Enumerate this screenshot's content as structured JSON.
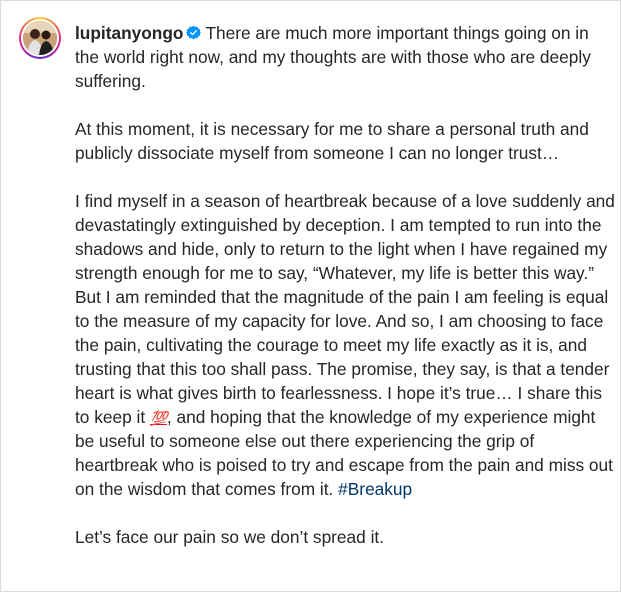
{
  "post": {
    "username": "lupitanyongo",
    "verified": true,
    "caption": {
      "p1": "There are much more important things going on in the world right now, and my thoughts are with those who are deeply suffering.",
      "p2": "At this moment, it is necessary for me to share a personal truth and publicly dissociate myself from someone I can no longer trust…",
      "p3_before_emoji": "I find myself in a season of heartbreak because of a love suddenly and devastatingly extinguished by deception. I am tempted to run into the shadows and hide, only to return to the light when I have regained my strength enough for me to say, “Whatever, my life is better this way.” But I am reminded that the magnitude of the pain I am feeling is equal to the measure of my capacity for love. And so, I am choosing to face the pain, cultivating the courage to meet my life exactly as it is, and trusting that this too shall pass. The promise, they say, is that a tender heart is what gives birth to fearlessness. I hope it’s true… I share this to keep it ",
      "emoji": "💯",
      "p3_after_emoji": ", and hoping that the knowledge of my experience might be useful to someone else out there experiencing the grip of heartbreak who is poised to try and escape from the pain and miss out on the wisdom that comes from it.  ",
      "hashtag": "#Breakup",
      "p4": "Let’s face our pain so we don’t spread it."
    }
  },
  "icons": {
    "verified": "verified-badge-icon",
    "avatar": "profile-avatar"
  },
  "colors": {
    "text": "#262626",
    "hashtag": "#00376b",
    "verified": "#0095f6",
    "border": "#dbdbdb"
  }
}
